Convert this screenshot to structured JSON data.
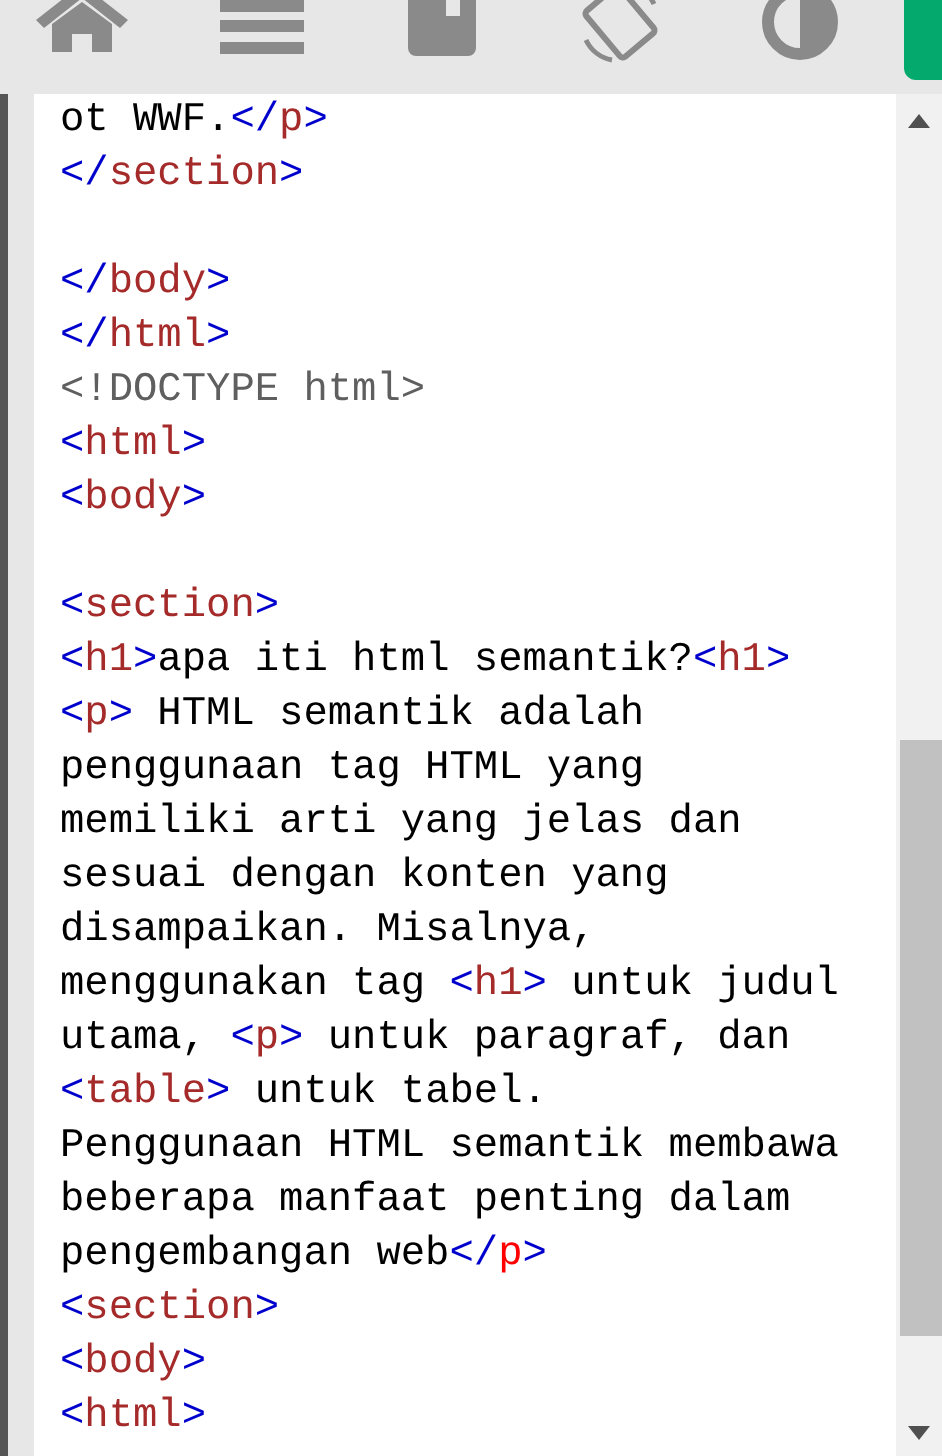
{
  "editor": {
    "lines": [
      {
        "kind": "code",
        "tokens": [
          {
            "kind": "text",
            "text": "ot WWF."
          },
          {
            "kind": "bracket",
            "text": "</"
          },
          {
            "kind": "tag",
            "text": "p"
          },
          {
            "kind": "bracket",
            "text": ">"
          }
        ]
      },
      {
        "kind": "code",
        "tokens": [
          {
            "kind": "bracket",
            "text": "</"
          },
          {
            "kind": "tag",
            "text": "section"
          },
          {
            "kind": "bracket",
            "text": ">"
          }
        ]
      },
      {
        "kind": "blank"
      },
      {
        "kind": "code",
        "tokens": [
          {
            "kind": "bracket",
            "text": "</"
          },
          {
            "kind": "tag",
            "text": "body"
          },
          {
            "kind": "bracket",
            "text": ">"
          }
        ]
      },
      {
        "kind": "code",
        "tokens": [
          {
            "kind": "bracket",
            "text": "</"
          },
          {
            "kind": "tag",
            "text": "html"
          },
          {
            "kind": "bracket",
            "text": ">"
          }
        ]
      },
      {
        "kind": "code",
        "tokens": [
          {
            "kind": "doctype",
            "text": "<!DOCTYPE html>"
          }
        ]
      },
      {
        "kind": "code",
        "tokens": [
          {
            "kind": "bracket",
            "text": "<"
          },
          {
            "kind": "tag",
            "text": "html"
          },
          {
            "kind": "bracket",
            "text": ">"
          }
        ]
      },
      {
        "kind": "code",
        "tokens": [
          {
            "kind": "bracket",
            "text": "<"
          },
          {
            "kind": "tag",
            "text": "body"
          },
          {
            "kind": "bracket",
            "text": ">"
          }
        ]
      },
      {
        "kind": "blank"
      },
      {
        "kind": "code",
        "tokens": [
          {
            "kind": "bracket",
            "text": "<"
          },
          {
            "kind": "tag",
            "text": "section"
          },
          {
            "kind": "bracket",
            "text": ">"
          }
        ]
      },
      {
        "kind": "code",
        "tokens": [
          {
            "kind": "bracket",
            "text": "<"
          },
          {
            "kind": "tag",
            "text": "h1"
          },
          {
            "kind": "bracket",
            "text": ">"
          },
          {
            "kind": "text",
            "text": "apa iti html semantik?"
          },
          {
            "kind": "bracket",
            "text": "<"
          },
          {
            "kind": "tag",
            "text": "h1"
          },
          {
            "kind": "bracket",
            "text": ">"
          }
        ]
      },
      {
        "kind": "code",
        "tokens": [
          {
            "kind": "bracket",
            "text": "<"
          },
          {
            "kind": "tag",
            "text": "p"
          },
          {
            "kind": "bracket",
            "text": ">"
          },
          {
            "kind": "text",
            "text": " HTML semantik adalah"
          }
        ]
      },
      {
        "kind": "code",
        "tokens": [
          {
            "kind": "text",
            "text": "penggunaan tag HTML yang"
          }
        ]
      },
      {
        "kind": "code",
        "tokens": [
          {
            "kind": "text",
            "text": "memiliki arti yang jelas dan"
          }
        ]
      },
      {
        "kind": "code",
        "tokens": [
          {
            "kind": "text",
            "text": "sesuai dengan konten yang"
          }
        ]
      },
      {
        "kind": "code",
        "tokens": [
          {
            "kind": "text",
            "text": "disampaikan. Misalnya,"
          }
        ]
      },
      {
        "kind": "code",
        "tokens": [
          {
            "kind": "text",
            "text": "menggunakan tag "
          },
          {
            "kind": "bracket",
            "text": "<"
          },
          {
            "kind": "tag",
            "text": "h1"
          },
          {
            "kind": "bracket",
            "text": ">"
          },
          {
            "kind": "text",
            "text": " untuk judul"
          }
        ]
      },
      {
        "kind": "code",
        "tokens": [
          {
            "kind": "text",
            "text": "utama, "
          },
          {
            "kind": "bracket",
            "text": "<"
          },
          {
            "kind": "tag",
            "text": "p"
          },
          {
            "kind": "bracket",
            "text": ">"
          },
          {
            "kind": "text",
            "text": " untuk paragraf, dan"
          }
        ]
      },
      {
        "kind": "code",
        "tokens": [
          {
            "kind": "bracket",
            "text": "<"
          },
          {
            "kind": "tag",
            "text": "table"
          },
          {
            "kind": "bracket",
            "text": ">"
          },
          {
            "kind": "text",
            "text": " untuk tabel."
          }
        ]
      },
      {
        "kind": "code",
        "tokens": [
          {
            "kind": "text",
            "text": "Penggunaan HTML semantik membawa"
          }
        ]
      },
      {
        "kind": "code",
        "tokens": [
          {
            "kind": "text",
            "text": "beberapa manfaat penting dalam"
          }
        ]
      },
      {
        "kind": "code",
        "tokens": [
          {
            "kind": "text",
            "text": "pengembangan web"
          },
          {
            "kind": "bracket",
            "text": "</"
          },
          {
            "kind": "match",
            "text": "p"
          },
          {
            "kind": "bracket",
            "text": ">"
          }
        ]
      },
      {
        "kind": "code",
        "tokens": [
          {
            "kind": "bracket",
            "text": "<"
          },
          {
            "kind": "tag",
            "text": "section"
          },
          {
            "kind": "bracket",
            "text": ">"
          }
        ]
      },
      {
        "kind": "code",
        "tokens": [
          {
            "kind": "bracket",
            "text": "<"
          },
          {
            "kind": "tag",
            "text": "body"
          },
          {
            "kind": "bracket",
            "text": ">"
          }
        ]
      },
      {
        "kind": "code",
        "tokens": [
          {
            "kind": "bracket",
            "text": "<"
          },
          {
            "kind": "tag",
            "text": "html"
          },
          {
            "kind": "bracket",
            "text": ">"
          }
        ]
      }
    ]
  }
}
